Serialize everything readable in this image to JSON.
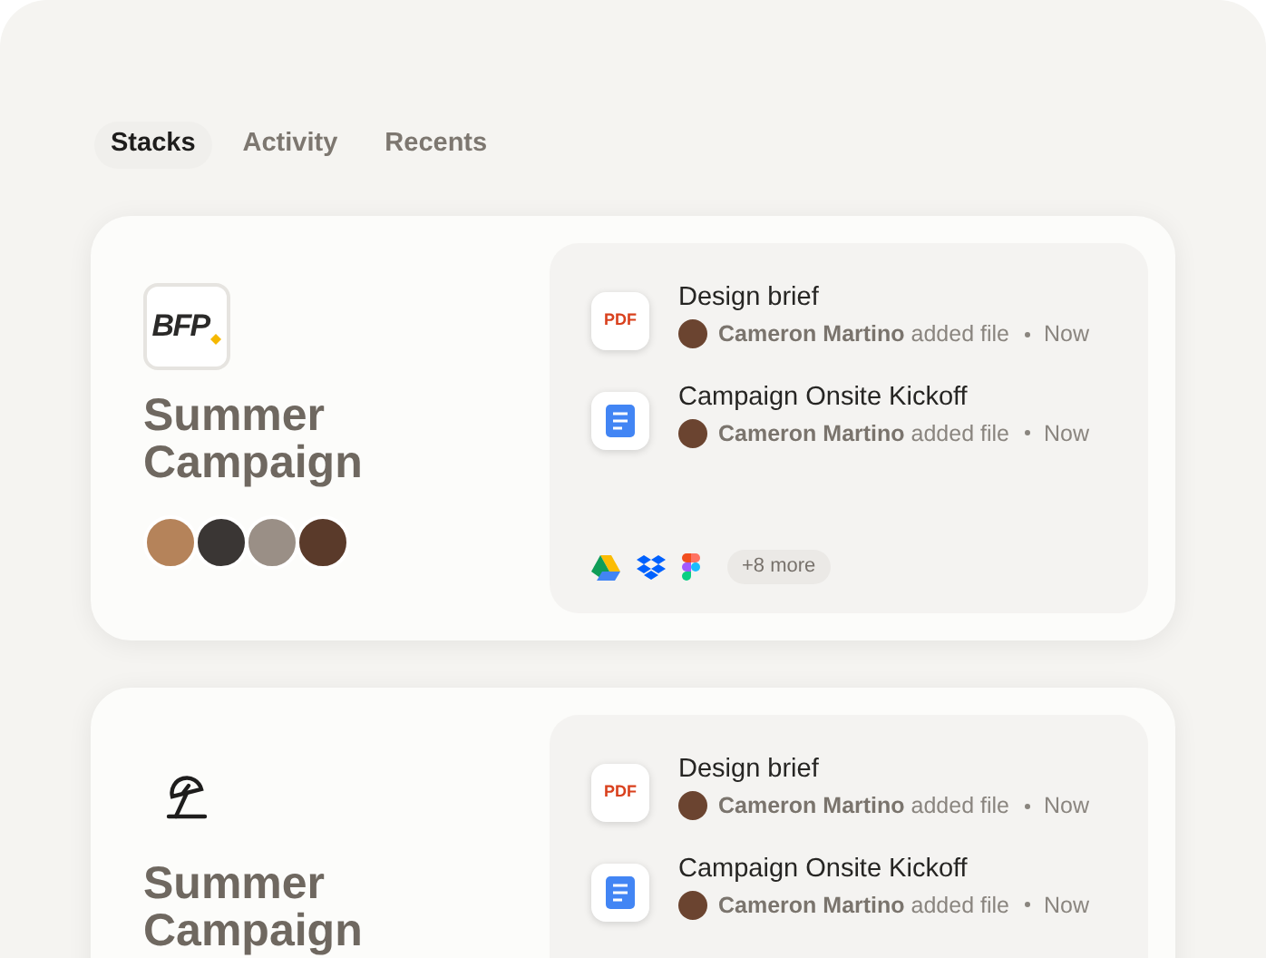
{
  "tabs": [
    {
      "label": "Stacks",
      "selected": true
    },
    {
      "label": "Activity",
      "selected": false
    },
    {
      "label": "Recents",
      "selected": false
    }
  ],
  "stacks": [
    {
      "logo": {
        "kind": "monogram",
        "text": "BFP"
      },
      "title": "Summer Campaign",
      "members": [
        {
          "color": "#b5835a"
        },
        {
          "color": "#3a3634"
        },
        {
          "color": "#9a8f86"
        },
        {
          "color": "#5a3a2a"
        }
      ],
      "files": [
        {
          "kind": "pdf",
          "badge": "PDF",
          "name": "Design brief",
          "author": "Cameron Martino",
          "action": "added file",
          "time": "Now"
        },
        {
          "kind": "doc",
          "name": "Campaign Onsite Kickoff",
          "author": "Cameron Martino",
          "action": "added file",
          "time": "Now"
        }
      ],
      "apps": [
        {
          "kind": "drive"
        },
        {
          "kind": "dropbox"
        },
        {
          "kind": "figma"
        }
      ],
      "more": "+8 more"
    },
    {
      "logo": {
        "kind": "umbrella"
      },
      "title": "Summer Campaign",
      "files": [
        {
          "kind": "pdf",
          "badge": "PDF",
          "name": "Design brief",
          "author": "Cameron Martino",
          "action": "added file",
          "time": "Now"
        },
        {
          "kind": "doc",
          "name": "Campaign Onsite Kickoff",
          "author": "Cameron Martino",
          "action": "added file",
          "time": "Now"
        }
      ]
    }
  ]
}
